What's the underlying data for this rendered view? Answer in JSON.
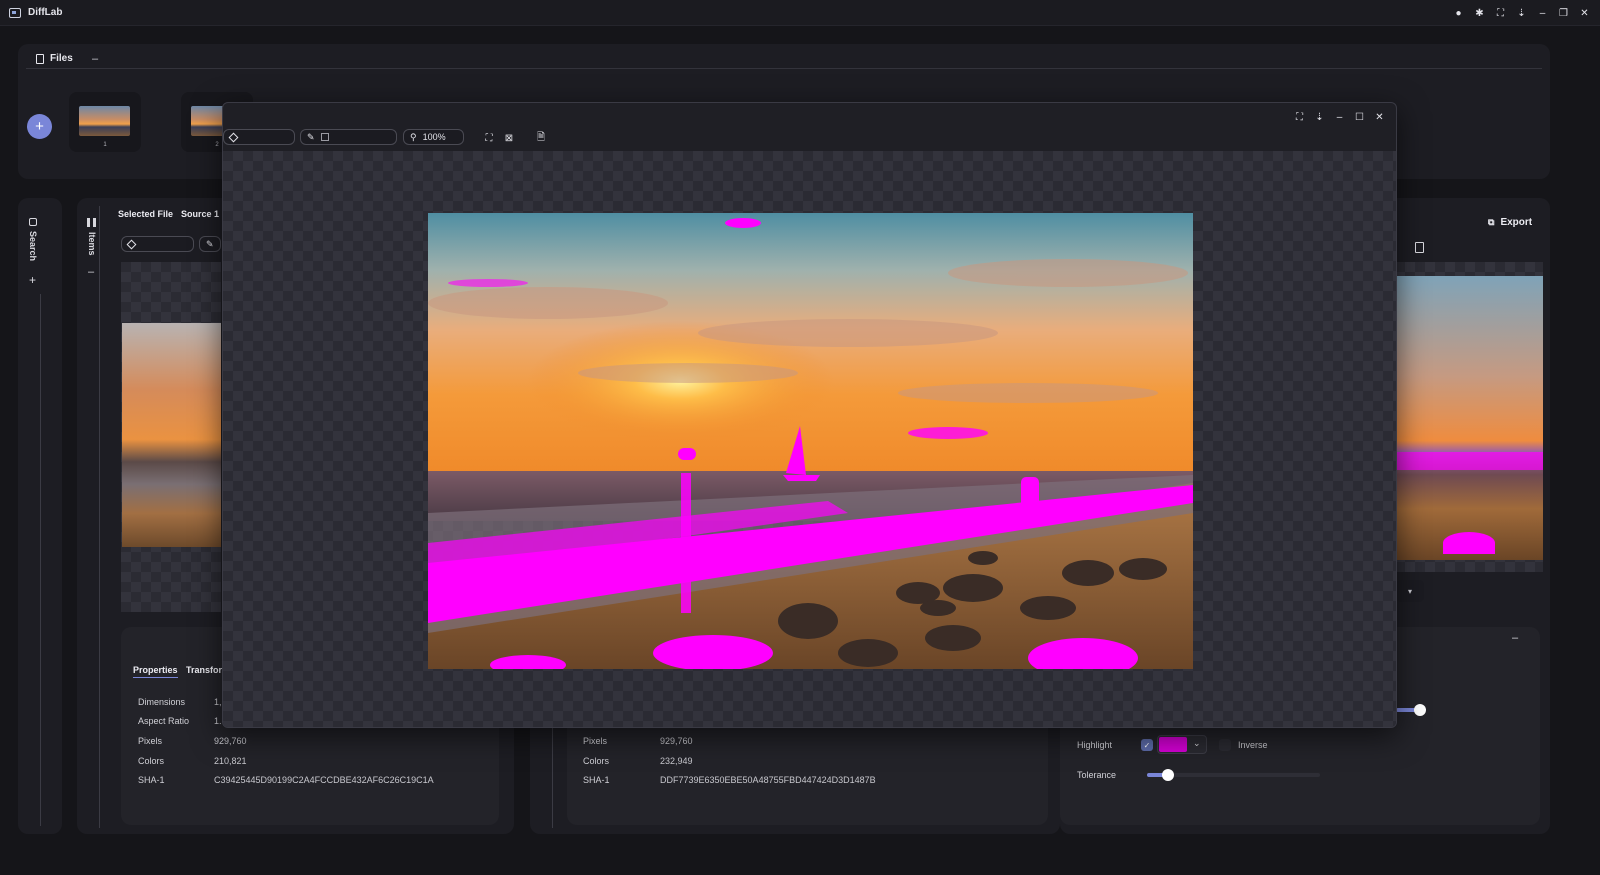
{
  "app": {
    "title": "DiffLab"
  },
  "files": {
    "tab_label": "Files",
    "thumbnails": [
      {
        "number": "1"
      },
      {
        "number": "2"
      }
    ]
  },
  "sidebar": {
    "search_label": "Search",
    "items_label": "Items"
  },
  "selected": {
    "selected_file_label": "Selected File",
    "source_label": "Source 1"
  },
  "viewer": {
    "zoom": "100%"
  },
  "export": {
    "label": "Export"
  },
  "left_props": {
    "tabs": [
      "Properties",
      "Transfor"
    ],
    "rows": [
      {
        "label": "Dimensions",
        "value": "1,"
      },
      {
        "label": "Aspect Ratio",
        "value": "1."
      },
      {
        "label": "Pixels",
        "value": "929,760"
      },
      {
        "label": "Colors",
        "value": "210,821"
      },
      {
        "label": "SHA-1",
        "value": "C39425445D90199C2A4FCCDBE432AF6C26C19C1A"
      }
    ]
  },
  "right_props": {
    "rows": [
      {
        "label": "Pixels",
        "value": "929,760"
      },
      {
        "label": "Colors",
        "value": "232,949"
      },
      {
        "label": "SHA-1",
        "value": "DDF7739E6350EBE50A48755FBD447424D3D1487B"
      }
    ]
  },
  "diff_settings": {
    "highlight_label": "Highlight",
    "highlight_color": "#d400d4",
    "highlight_checked": true,
    "inverse_label": "Inverse",
    "inverse_checked": false,
    "tolerance_label": "Tolerance",
    "tolerance_value_fraction": 0.12,
    "upper_slider_fraction": 1.0
  },
  "colors": {
    "accent": "#7a86d8",
    "diff_magenta": "#ff00ff"
  }
}
